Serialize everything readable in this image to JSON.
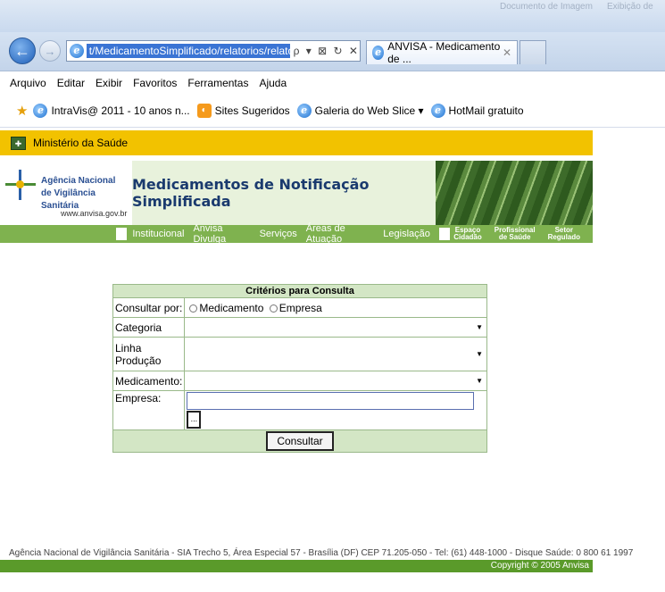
{
  "browser": {
    "address_url": "t/MedicamentoSimplificado/relatorios/relatorio.asp",
    "address_icons": "ρ ▾ ⊠ ↻ ✕",
    "tab_title": "ANVISA - Medicamento de ...",
    "tab_close": "✕",
    "blurred_titles": [
      "Documento de Imagem",
      "Exibição de"
    ]
  },
  "menu": [
    "Arquivo",
    "Editar",
    "Exibir",
    "Favoritos",
    "Ferramentas",
    "Ajuda"
  ],
  "favorites": [
    {
      "label": "IntraVis@ 2011 - 10 anos n...",
      "icon": "ie-icon"
    },
    {
      "label": "Sites Sugeridos",
      "icon": "sites-icon"
    },
    {
      "label": "Galeria do Web Slice ▾",
      "icon": "ie-icon"
    },
    {
      "label": "HotMail gratuito",
      "icon": "ie-icon"
    }
  ],
  "page": {
    "ministerio": "Ministério da Saúde",
    "org_line1": "Agência Nacional",
    "org_line2": "de Vigilância Sanitária",
    "org_url": "www.anvisa.gov.br",
    "title": "Medicamentos de Notificação Simplificada",
    "nav": [
      "Institucional",
      "Anvisa Divulga",
      "Serviços",
      "Áreas de Atuação",
      "Legislação"
    ],
    "subnav": [
      {
        "l1": "Espaço",
        "l2": "Cidadão"
      },
      {
        "l1": "Profissional",
        "l2": "de Saúde"
      },
      {
        "l1": "Setor",
        "l2": "Regulado"
      }
    ]
  },
  "form": {
    "header": "Critérios para Consulta",
    "consultar_por_label": "Consultar por:",
    "radio_medicamento": "Medicamento",
    "radio_empresa": "Empresa",
    "categoria_label": "Categoria",
    "linha_label": "Linha Produção",
    "medicamento_label": "Medicamento:",
    "empresa_label": "Empresa:",
    "lookup_label": "...",
    "submit_label": "Consultar"
  },
  "footer": {
    "address": "Agência Nacional de Vigilância Sanitária - SIA Trecho 5, Área Especial 57 - Brasília (DF) CEP 71.205-050 - Tel: (61) 448-1000 - Disque Saúde: 0 800 61 1997",
    "copyright": "Copyright © 2005 Anvisa"
  },
  "colors": {
    "ministry_bar": "#f2c200",
    "nav_green": "#7fb24f",
    "footer_green": "#5a9a2a"
  }
}
